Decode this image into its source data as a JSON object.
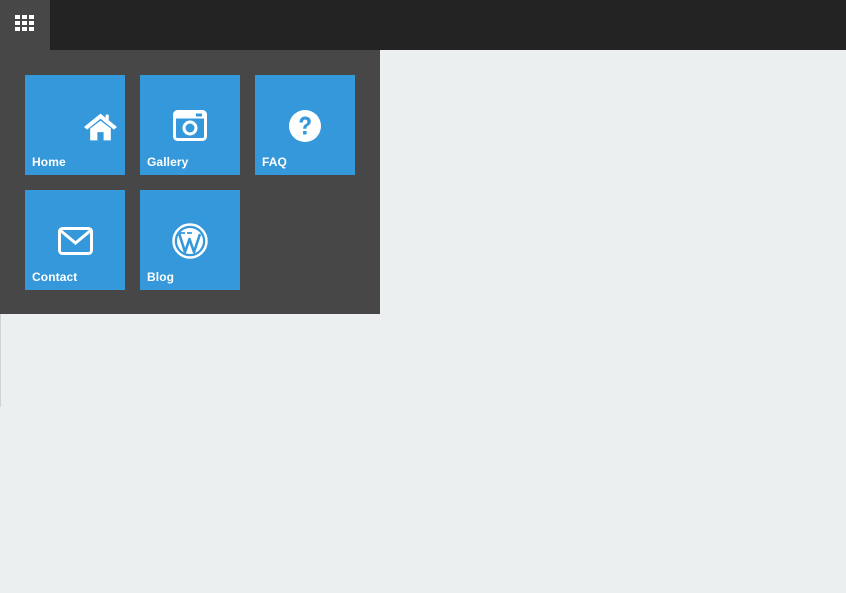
{
  "topbar": {
    "menu_icon": "grid-icon",
    "colors": {
      "bar": "#232323",
      "toggle": "#474747"
    }
  },
  "panel": {
    "background": "#474747",
    "tile_color": "#3498db",
    "tiles": [
      {
        "label": "Home",
        "icon": "home-icon"
      },
      {
        "label": "Gallery",
        "icon": "camera-icon"
      },
      {
        "label": "FAQ",
        "icon": "question-icon"
      },
      {
        "label": "Contact",
        "icon": "envelope-icon"
      },
      {
        "label": "Blog",
        "icon": "wordpress-icon"
      }
    ]
  },
  "page": {
    "background": "#ebeff0"
  }
}
